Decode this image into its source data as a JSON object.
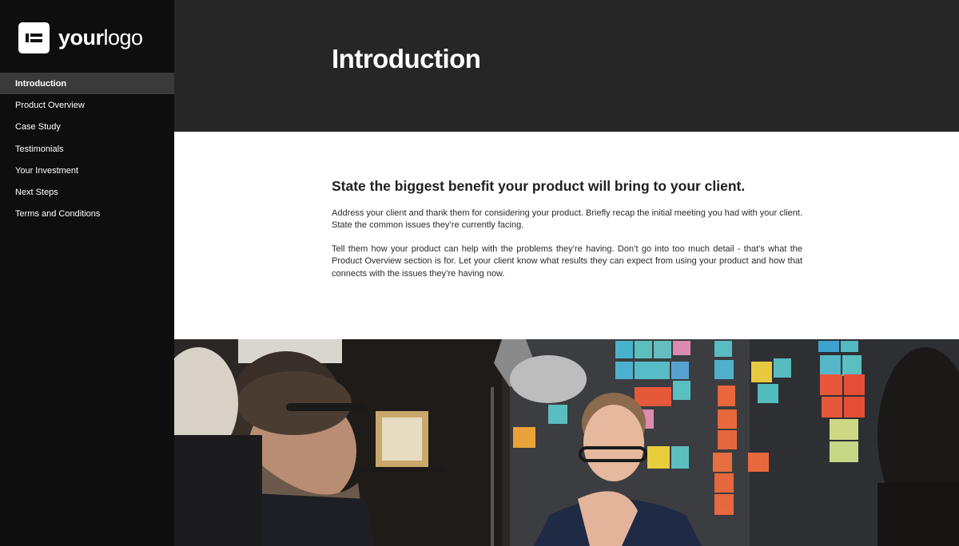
{
  "logo": {
    "brand_bold": "your",
    "brand_light": "logo",
    "icon": "logo-mark-icon"
  },
  "sidebar": {
    "items": [
      {
        "label": "Introduction",
        "active": true
      },
      {
        "label": "Product Overview",
        "active": false
      },
      {
        "label": "Case Study",
        "active": false
      },
      {
        "label": "Testimonials",
        "active": false
      },
      {
        "label": "Your Investment",
        "active": false
      },
      {
        "label": "Next Steps",
        "active": false
      },
      {
        "label": "Terms and Conditions",
        "active": false
      }
    ]
  },
  "header": {
    "title": "Introduction"
  },
  "main": {
    "headline": "State the biggest benefit your product will bring to your client.",
    "paragraph1": "Address your client and thank them for considering your product. Briefly recap the initial meeting you had with your client. State the common issues they’re currently facing.",
    "paragraph2": "Tell them how your product can help with the problems they’re having. Don’t go into too much detail - that’s what the Product Overview section is for. Let your client know what results they can expect from using your product and how that connects with the issues they’re having now."
  },
  "colors": {
    "sidebar_bg": "#0e0e0e",
    "active_item_bg": "#3a3a3a",
    "header_bg": "#262626",
    "content_bg": "#ffffff"
  }
}
